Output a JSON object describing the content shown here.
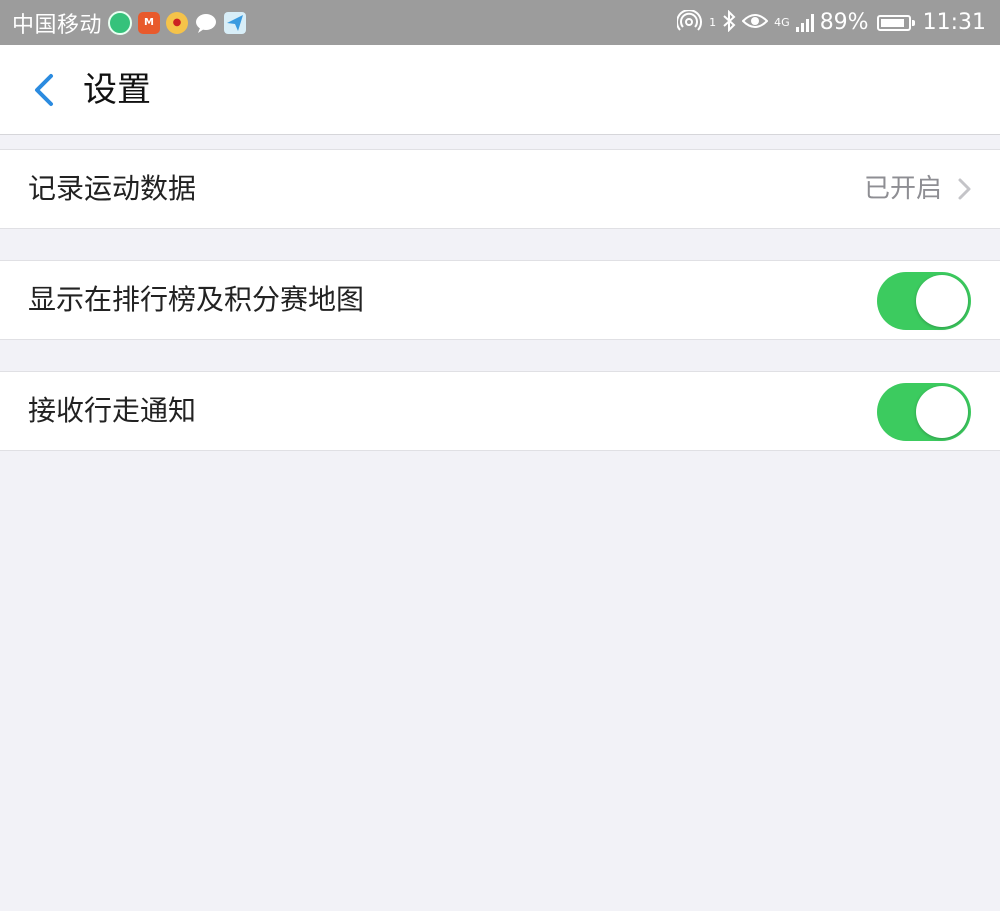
{
  "status_bar": {
    "carrier": "中国移动",
    "battery_percent": "89%",
    "battery_level": 0.89,
    "time": "11:31",
    "network": "4G",
    "hotspot_count": "1",
    "app_icons": [
      "green-app-icon",
      "orange-app-icon",
      "weibo-icon",
      "chat-bubble-icon",
      "paper-plane-icon"
    ],
    "status_icons": [
      "hotspot-icon",
      "bluetooth-icon",
      "eye-icon",
      "signal-icon",
      "battery-icon"
    ]
  },
  "header": {
    "back_icon": "chevron-left-icon",
    "title": "设置",
    "accent_color": "#2b8be0"
  },
  "settings": [
    {
      "label": "记录运动数据",
      "value": "已开启",
      "type": "disclosure"
    },
    {
      "label": "显示在排行榜及积分赛地图",
      "type": "toggle",
      "on": true
    },
    {
      "label": "接收行走通知",
      "type": "toggle",
      "on": true
    }
  ],
  "colors": {
    "background": "#f2f2f7",
    "toggle_on": "#3ccb5f",
    "status_bar": "#9c9c9c"
  }
}
